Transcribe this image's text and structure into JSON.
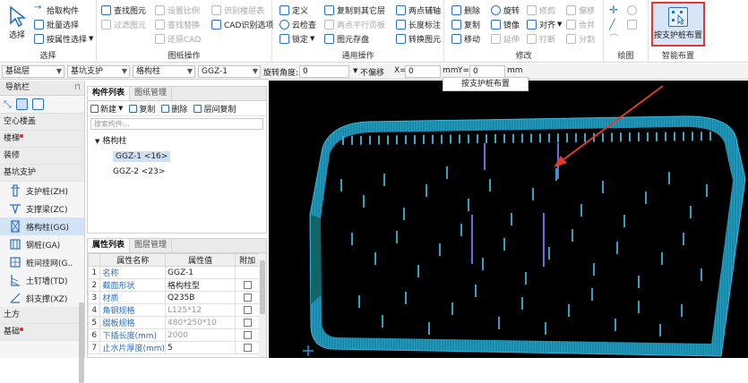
{
  "ribbon": {
    "select": {
      "label": "选择"
    },
    "select_group": {
      "title": "选择",
      "items": [
        "拾取构件",
        "批量选择",
        "按属性选择"
      ]
    },
    "drawing_group": {
      "title": "图纸操作",
      "col1": [
        "查找图元",
        "过滤图元"
      ],
      "col2": [
        "设置比例",
        "查找替换",
        "还原CAD"
      ],
      "col3": [
        "识别楼层表",
        "CAD识别选项"
      ]
    },
    "common_group": {
      "title": "通用操作",
      "col1": [
        "定义",
        "云检查",
        "锁定"
      ],
      "col2": [
        "复制到其它层",
        "两点平行页板",
        "图元存盘"
      ],
      "col3": [
        "两点辅轴",
        "长度标注",
        "转换图元"
      ]
    },
    "modify_group": {
      "title": "修改",
      "col1": [
        "删除",
        "复制",
        "移动"
      ],
      "col2": [
        "旋转",
        "镜像",
        "延伸"
      ],
      "col3": [
        "修剪",
        "对齐",
        "打断"
      ],
      "col4": [
        "偏移",
        "合并",
        "分割"
      ]
    },
    "draw_group": {
      "title": "绘图"
    },
    "smart_group": {
      "title": "智能布置",
      "button_label": "按支护桩布置"
    }
  },
  "propbar": {
    "floor": "基础层",
    "category": "基坑支护",
    "type": "格构柱",
    "name": "GGZ-1",
    "rotate_label": "旋转角度:",
    "rotate_value": "0",
    "offset": "不偏移",
    "x_label": "X=",
    "x_value": "0",
    "mm1": "mm",
    "y_label": "Y=",
    "y_value": "0",
    "mm2": "mm"
  },
  "tooltip": "按支护桩布置",
  "nav": {
    "header": "导航栏",
    "cats": {
      "c1": "空心楼盖",
      "c2": "楼梯",
      "c3": "装修",
      "c4": "基坑支护",
      "c5": "土方",
      "c6": "基础"
    },
    "items": [
      {
        "label": "支护桩(ZH)"
      },
      {
        "label": "支撑梁(ZC)"
      },
      {
        "label": "格构柱(GG)"
      },
      {
        "label": "钢桩(GA)"
      },
      {
        "label": "桩间挂网(G.."
      },
      {
        "label": "土钉墙(TD)"
      },
      {
        "label": "斜支撑(XZ)"
      }
    ]
  },
  "complist": {
    "tab1": "构件列表",
    "tab2": "图纸管理",
    "new": "新建",
    "copy": "复制",
    "delete": "删除",
    "layer_copy": "层间复制",
    "search_placeholder": "搜索构件...",
    "tree_root": "格构柱",
    "tree_items": [
      "GGZ-1 <16>",
      "GGZ-2 <23>"
    ]
  },
  "props": {
    "tab1": "属性列表",
    "tab2": "图层管理",
    "col_name": "属性名称",
    "col_value": "属性值",
    "col_add": "附加",
    "rows": [
      {
        "n": "1",
        "name": "名称",
        "value": "GGZ-1"
      },
      {
        "n": "2",
        "name": "截面形状",
        "value": "格构柱型"
      },
      {
        "n": "3",
        "name": "材质",
        "value": "Q235B"
      },
      {
        "n": "4",
        "name": "角钢规格",
        "value": "L125*12"
      },
      {
        "n": "5",
        "name": "缀板规格",
        "value": "480*250*10"
      },
      {
        "n": "6",
        "name": "下插长度(mm)",
        "value": "2000"
      },
      {
        "n": "7",
        "name": "止水片厚度(mm)",
        "value": "5"
      }
    ]
  },
  "colors": {
    "accent": "#2b6fc4",
    "highlight_border": "#e03b2f",
    "wall": "#1d95b8",
    "canvas_bg": "#000000"
  }
}
